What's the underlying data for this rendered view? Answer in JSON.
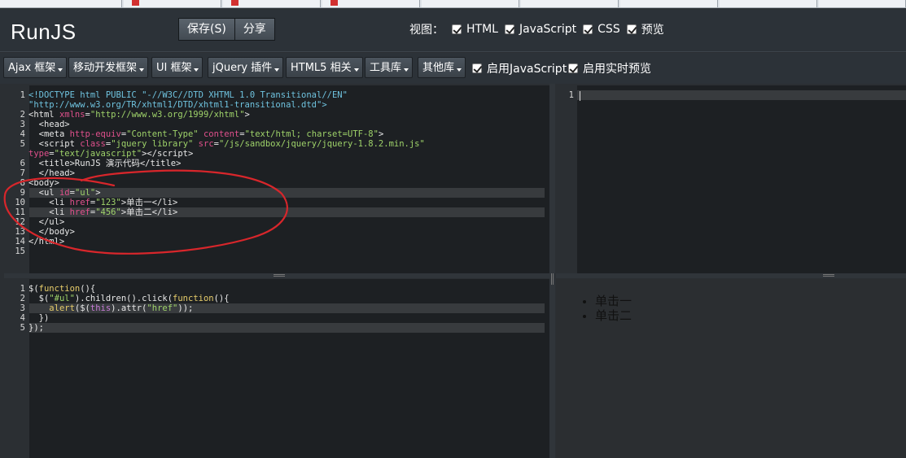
{
  "app": {
    "logo": "RunJS"
  },
  "header": {
    "save_label": "保存(S)",
    "share_label": "分享",
    "views_label": "视图：",
    "view_options": [
      {
        "label": "HTML",
        "checked": true
      },
      {
        "label": "JavaScript",
        "checked": true
      },
      {
        "label": "CSS",
        "checked": true
      },
      {
        "label": "预览",
        "checked": true
      }
    ]
  },
  "toolbar": {
    "menus": [
      "Ajax 框架",
      "移动开发框架",
      "UI 框架",
      "jQuery 插件",
      "HTML5 相关",
      "工具库",
      "其他库"
    ],
    "enable_js": {
      "label": "启用JavaScript",
      "checked": true
    },
    "enable_live": {
      "label": "启用实时预览",
      "checked": true
    }
  },
  "html_editor": {
    "line_numbers": [
      "1",
      "",
      "2",
      "3",
      "4",
      "5",
      "",
      "6",
      "7",
      "8",
      "9",
      "10",
      "11",
      "12",
      "13",
      "14",
      "15"
    ],
    "highlight_color": "#383b3e"
  },
  "css_editor": {
    "line_numbers": [
      "1"
    ]
  },
  "js_editor": {
    "line_numbers": [
      "1",
      "2",
      "3",
      "4",
      "5"
    ]
  },
  "preview": {
    "items": [
      "单击一",
      "单击二"
    ]
  },
  "colors": {
    "annotation": "#d8262b",
    "background": "#2b2f33",
    "editor_bg": "#1d2023"
  }
}
